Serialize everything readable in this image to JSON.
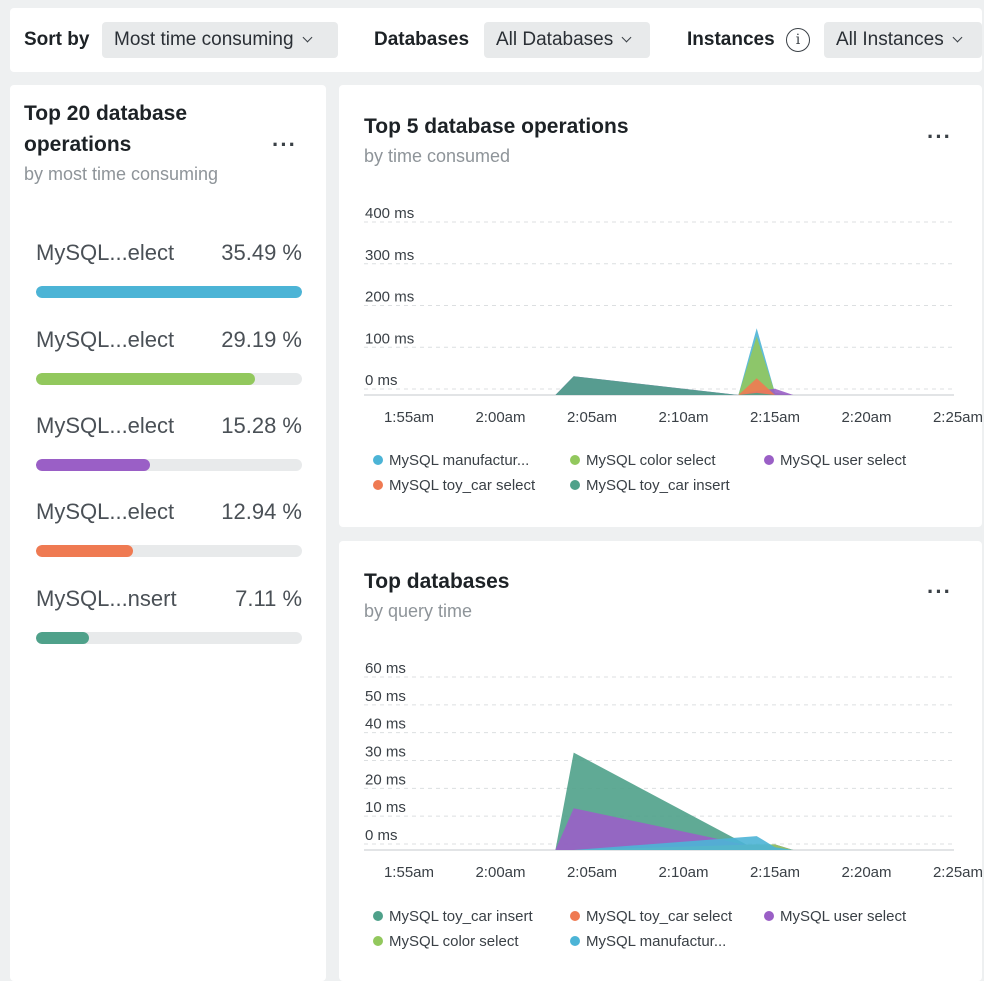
{
  "toolbar": {
    "sort_label": "Sort by",
    "sort_value": "Most time consuming",
    "databases_label": "Databases",
    "databases_value": "All Databases",
    "instances_label": "Instances",
    "instances_value": "All Instances",
    "info_glyph": "i"
  },
  "top_ops": {
    "title_line1": "Top 20 database",
    "title_line2": "operations",
    "subtitle": "by most time consuming",
    "more": "···",
    "items": [
      {
        "name": "MySQL...elect",
        "percent_text": "35.49 %",
        "fraction": 1.0,
        "color": "#4cb4d6"
      },
      {
        "name": "MySQL...elect",
        "percent_text": "29.19 %",
        "fraction": 0.823,
        "color": "#92c85d"
      },
      {
        "name": "MySQL...elect",
        "percent_text": "15.28 %",
        "fraction": 0.43,
        "color": "#9a5fc6"
      },
      {
        "name": "MySQL...elect",
        "percent_text": "12.94 %",
        "fraction": 0.364,
        "color": "#ef7a52"
      },
      {
        "name": "MySQL...nsert",
        "percent_text": "7.11 %",
        "fraction": 0.2,
        "color": "#4fa18a"
      }
    ]
  },
  "top5": {
    "title": "Top 5 database operations",
    "subtitle": "by time consumed",
    "more": "···"
  },
  "topdb": {
    "title": "Top databases",
    "subtitle": "by query time",
    "more": "···"
  },
  "chart_data": [
    {
      "type": "area",
      "title": "Top 5 database operations",
      "subtitle": "by time consumed",
      "y_unit": "ms",
      "ylim": [
        0,
        400
      ],
      "y_ticks": [
        "400 ms",
        "300 ms",
        "200 ms",
        "100 ms",
        "0 ms"
      ],
      "x_ticks": [
        "1:55am",
        "2:00am",
        "2:05am",
        "2:10am",
        "2:15am",
        "2:20am",
        "2:25am"
      ],
      "grid": true,
      "legend_position": "bottom",
      "series": [
        {
          "name": "MySQL manufactur...",
          "color": "#4cb4d6",
          "points": [
            {
              "x": "2:04am",
              "y": 0
            },
            {
              "x": "2:13am",
              "y": 0
            },
            {
              "x": "2:14am",
              "y": 160
            },
            {
              "x": "2:15am",
              "y": 5
            },
            {
              "x": "2:16am",
              "y": 0
            }
          ]
        },
        {
          "name": "MySQL color select",
          "color": "#92c85d",
          "points": [
            {
              "x": "2:04am",
              "y": 5
            },
            {
              "x": "2:13am",
              "y": 0
            },
            {
              "x": "2:14am",
              "y": 140
            },
            {
              "x": "2:15am",
              "y": 5
            },
            {
              "x": "2:16am",
              "y": 0
            }
          ]
        },
        {
          "name": "MySQL user select",
          "color": "#9a5fc6",
          "points": [
            {
              "x": "2:04am",
              "y": 45
            },
            {
              "x": "2:13am",
              "y": 0
            },
            {
              "x": "2:14am",
              "y": 10
            },
            {
              "x": "2:15am",
              "y": 15
            },
            {
              "x": "2:16am",
              "y": 0
            }
          ]
        },
        {
          "name": "MySQL toy_car select",
          "color": "#ef7a52",
          "points": [
            {
              "x": "2:04am",
              "y": 0
            },
            {
              "x": "2:13am",
              "y": 0
            },
            {
              "x": "2:14am",
              "y": 40
            },
            {
              "x": "2:15am",
              "y": 0
            },
            {
              "x": "2:16am",
              "y": 0
            }
          ]
        },
        {
          "name": "MySQL toy_car insert",
          "color": "#4fa18a",
          "points": [
            {
              "x": "2:04am",
              "y": 45
            },
            {
              "x": "2:13am",
              "y": 0
            },
            {
              "x": "2:14am",
              "y": 5
            },
            {
              "x": "2:15am",
              "y": 0
            },
            {
              "x": "2:16am",
              "y": 0
            }
          ]
        }
      ]
    },
    {
      "type": "area",
      "title": "Top databases",
      "subtitle": "by query time",
      "y_unit": "ms",
      "ylim": [
        0,
        60
      ],
      "y_ticks": [
        "60 ms",
        "50 ms",
        "40 ms",
        "30 ms",
        "20 ms",
        "10 ms",
        "0 ms"
      ],
      "x_ticks": [
        "1:55am",
        "2:00am",
        "2:05am",
        "2:10am",
        "2:15am",
        "2:20am",
        "2:25am"
      ],
      "grid": true,
      "legend_position": "bottom",
      "series": [
        {
          "name": "MySQL toy_car insert",
          "color": "#4fa18a",
          "points": [
            {
              "x": "2:04am",
              "y": 35
            },
            {
              "x": "2:14am",
              "y": 0
            },
            {
              "x": "2:15am",
              "y": 0
            }
          ]
        },
        {
          "name": "MySQL toy_car select",
          "color": "#ef7a52",
          "points": [
            {
              "x": "2:04am",
              "y": 0
            },
            {
              "x": "2:14am",
              "y": 2
            },
            {
              "x": "2:15am",
              "y": 0
            }
          ]
        },
        {
          "name": "MySQL user select",
          "color": "#9a5fc6",
          "points": [
            {
              "x": "2:04am",
              "y": 15
            },
            {
              "x": "2:14am",
              "y": 1
            },
            {
              "x": "2:15am",
              "y": 2
            }
          ]
        },
        {
          "name": "MySQL color select",
          "color": "#92c85d",
          "points": [
            {
              "x": "2:04am",
              "y": 0
            },
            {
              "x": "2:14am",
              "y": 2
            },
            {
              "x": "2:15am",
              "y": 2
            }
          ]
        },
        {
          "name": "MySQL manufactur...",
          "color": "#4cb4d6",
          "points": [
            {
              "x": "2:04am",
              "y": 0
            },
            {
              "x": "2:14am",
              "y": 5
            },
            {
              "x": "2:15am",
              "y": 1
            }
          ]
        }
      ]
    }
  ]
}
